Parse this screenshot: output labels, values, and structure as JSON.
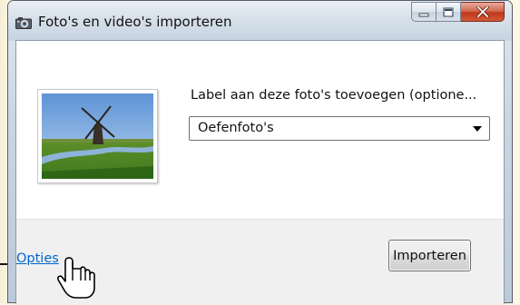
{
  "window": {
    "title": "Foto's en video's importeren",
    "icon": "camera-icon",
    "buttons": {
      "minimize_icon": "minimize-icon",
      "maximize_icon": "maximize-icon",
      "close_icon": "close-icon"
    }
  },
  "content": {
    "thumbnail": "windmill-photo",
    "label_prompt": "Label aan deze foto's toevoegen (optione...",
    "tag_combo": {
      "value": "Oefenfoto's"
    }
  },
  "footer": {
    "options_link": "Opties",
    "import_button": "Importeren"
  },
  "colors": {
    "link": "#0066cc",
    "close_button": "#c0371c",
    "chrome": "#c9d6e2"
  }
}
